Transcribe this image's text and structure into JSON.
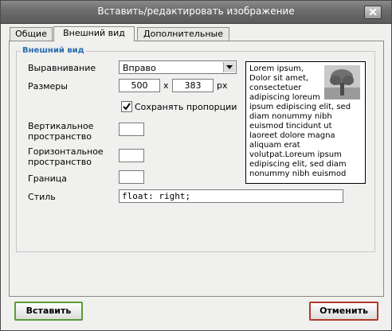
{
  "window": {
    "title": "Вставить/редактировать изображение"
  },
  "tabs": [
    {
      "label": "Общие",
      "active": false
    },
    {
      "label": "Внешний вид",
      "active": true
    },
    {
      "label": "Дополнительные",
      "active": false
    }
  ],
  "appearance": {
    "legend": "Внешний вид",
    "alignment": {
      "label": "Выравнивание",
      "value": "Вправо"
    },
    "dimensions": {
      "label": "Размеры",
      "width": "500",
      "separator": "x",
      "height": "383",
      "unit": "px"
    },
    "constrain": {
      "label": "Сохранять пропорции",
      "checked": true
    },
    "vspace": {
      "label_line1": "Вертикальное",
      "label_line2": "пространство",
      "value": ""
    },
    "hspace": {
      "label_line1": "Горизонтальное",
      "label_line2": "пространство",
      "value": ""
    },
    "border": {
      "label": "Граница",
      "value": ""
    },
    "style": {
      "label": "Стиль",
      "value": "float: right;"
    },
    "preview_text": "Lorem ipsum, Dolor sit amet, consectetuer adipiscing loreum ipsum edipiscing elit, sed diam nonummy nibh euismod tincidunt ut laoreet dolore magna aliquam erat volutpat.Loreum ipsum edipiscing elit, sed diam nonummy nibh euismod"
  },
  "buttons": {
    "insert": "Вставить",
    "cancel": "Отменить"
  },
  "colors": {
    "legend": "#2b6cb0",
    "insert_border": "#5a9a3a",
    "cancel_border": "#b23a2a"
  }
}
